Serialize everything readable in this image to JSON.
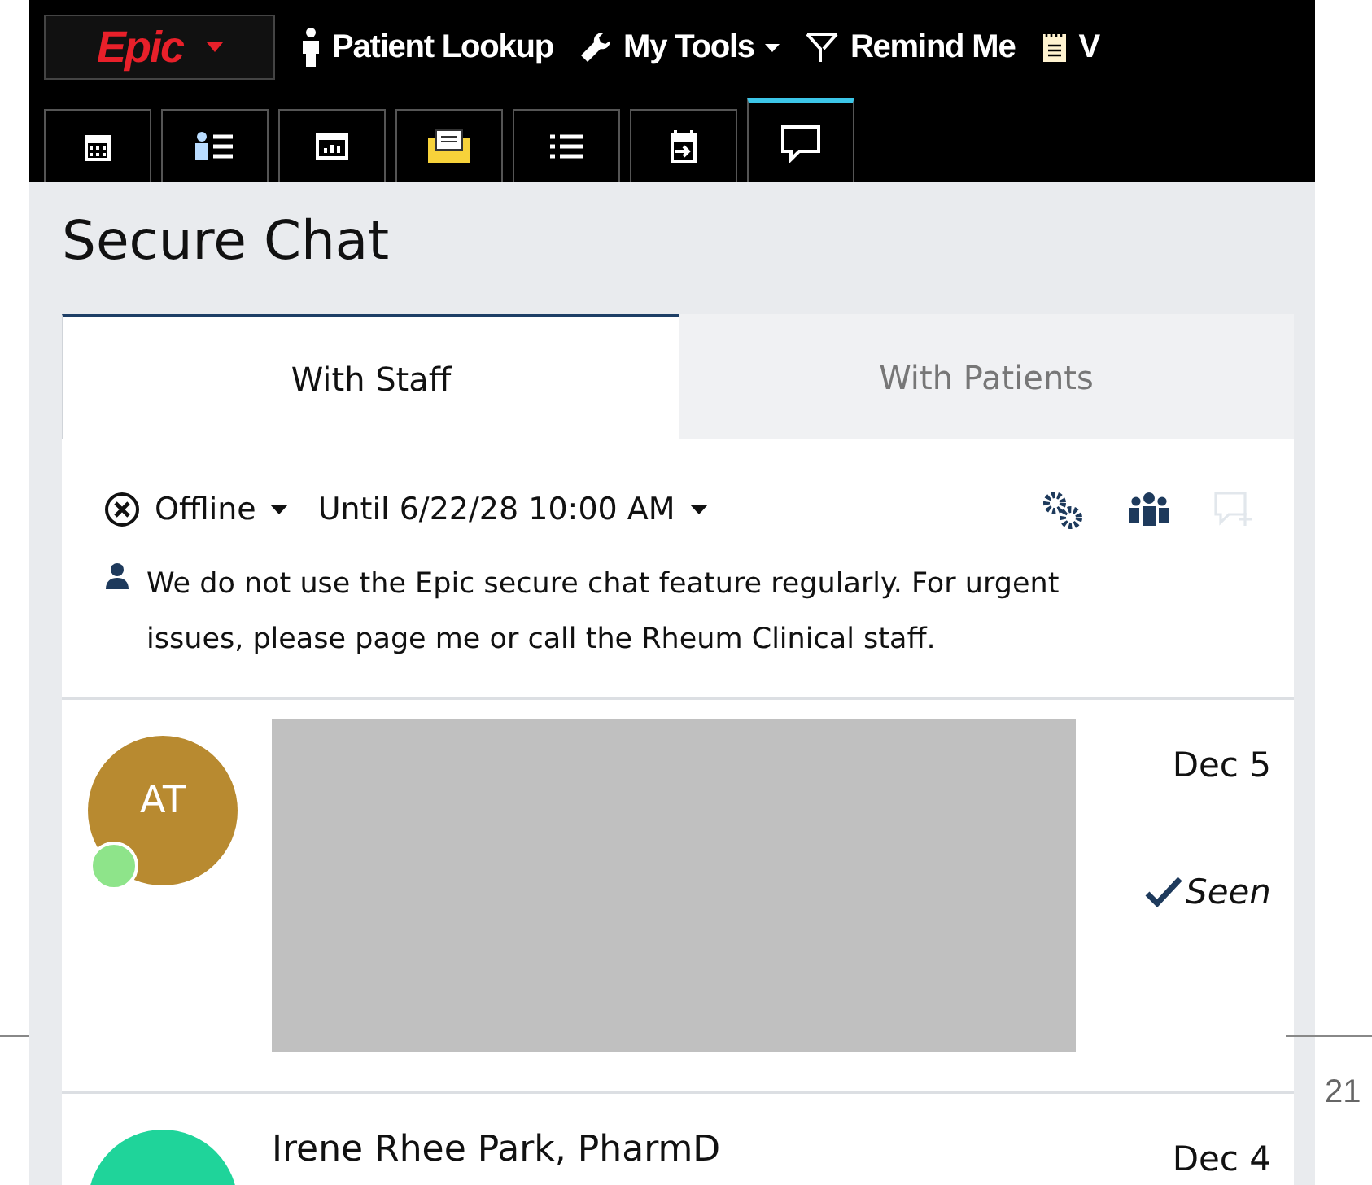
{
  "app_menu": {
    "label": "Epic"
  },
  "toolbar": [
    {
      "kind": "lookup",
      "label": "Patient Lookup",
      "dropdown": false
    },
    {
      "kind": "tools",
      "label": "My Tools",
      "dropdown": true
    },
    {
      "kind": "remind",
      "label": "Remind Me",
      "dropdown": false
    },
    {
      "kind": "notes",
      "label": "V",
      "dropdown": false
    }
  ],
  "activity_tabs": [
    {
      "kind": "calendar",
      "selected": false
    },
    {
      "kind": "patient-list",
      "selected": false
    },
    {
      "kind": "report",
      "selected": false
    },
    {
      "kind": "inbox",
      "selected": false
    },
    {
      "kind": "list",
      "selected": false
    },
    {
      "kind": "schedule",
      "selected": false
    },
    {
      "kind": "chat",
      "selected": true
    }
  ],
  "title": "Secure Chat",
  "tabs": [
    {
      "label": "With Staff",
      "selected": true
    },
    {
      "label": "With Patients",
      "selected": false
    }
  ],
  "status": {
    "label": "Offline",
    "until": "Until 6/22/28 10:00 AM",
    "message": "We do not use the Epic secure chat feature regularly. For urgent issues, please page me or call the Rheum Clinical staff.",
    "compose_disabled": true
  },
  "conversations": [
    {
      "initials": "AT",
      "color": "#b88a30",
      "online": true,
      "date": "Dec 5",
      "seen_label": "Seen",
      "redacted": true
    },
    {
      "name": "Irene Rhee Park, PharmD",
      "color": "#1fd49a",
      "online": false,
      "date": "Dec 4",
      "redacted": false
    }
  ],
  "slide": {
    "page_number": "21"
  }
}
